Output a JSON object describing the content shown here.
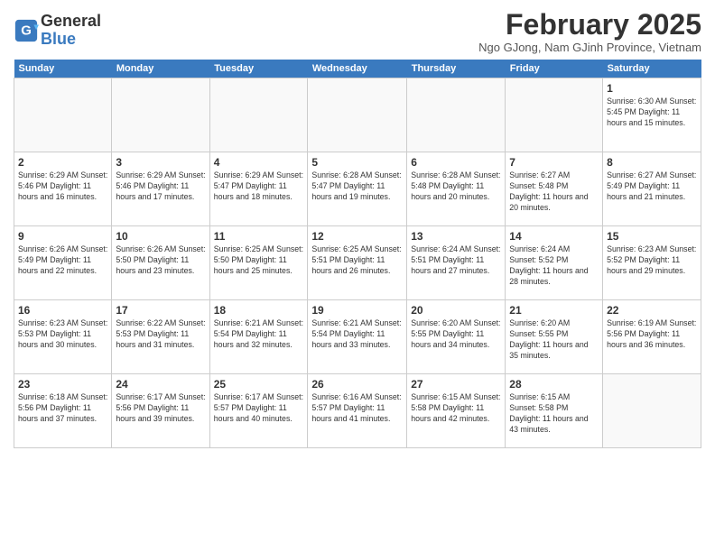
{
  "logo": {
    "line1": "General",
    "line2": "Blue"
  },
  "title": "February 2025",
  "subtitle": "Ngo GJong, Nam GJinh Province, Vietnam",
  "days_of_week": [
    "Sunday",
    "Monday",
    "Tuesday",
    "Wednesday",
    "Thursday",
    "Friday",
    "Saturday"
  ],
  "weeks": [
    [
      {
        "day": "",
        "info": ""
      },
      {
        "day": "",
        "info": ""
      },
      {
        "day": "",
        "info": ""
      },
      {
        "day": "",
        "info": ""
      },
      {
        "day": "",
        "info": ""
      },
      {
        "day": "",
        "info": ""
      },
      {
        "day": "1",
        "info": "Sunrise: 6:30 AM\nSunset: 5:45 PM\nDaylight: 11 hours and 15 minutes."
      }
    ],
    [
      {
        "day": "2",
        "info": "Sunrise: 6:29 AM\nSunset: 5:46 PM\nDaylight: 11 hours and 16 minutes."
      },
      {
        "day": "3",
        "info": "Sunrise: 6:29 AM\nSunset: 5:46 PM\nDaylight: 11 hours and 17 minutes."
      },
      {
        "day": "4",
        "info": "Sunrise: 6:29 AM\nSunset: 5:47 PM\nDaylight: 11 hours and 18 minutes."
      },
      {
        "day": "5",
        "info": "Sunrise: 6:28 AM\nSunset: 5:47 PM\nDaylight: 11 hours and 19 minutes."
      },
      {
        "day": "6",
        "info": "Sunrise: 6:28 AM\nSunset: 5:48 PM\nDaylight: 11 hours and 20 minutes."
      },
      {
        "day": "7",
        "info": "Sunrise: 6:27 AM\nSunset: 5:48 PM\nDaylight: 11 hours and 20 minutes."
      },
      {
        "day": "8",
        "info": "Sunrise: 6:27 AM\nSunset: 5:49 PM\nDaylight: 11 hours and 21 minutes."
      }
    ],
    [
      {
        "day": "9",
        "info": "Sunrise: 6:26 AM\nSunset: 5:49 PM\nDaylight: 11 hours and 22 minutes."
      },
      {
        "day": "10",
        "info": "Sunrise: 6:26 AM\nSunset: 5:50 PM\nDaylight: 11 hours and 23 minutes."
      },
      {
        "day": "11",
        "info": "Sunrise: 6:25 AM\nSunset: 5:50 PM\nDaylight: 11 hours and 25 minutes."
      },
      {
        "day": "12",
        "info": "Sunrise: 6:25 AM\nSunset: 5:51 PM\nDaylight: 11 hours and 26 minutes."
      },
      {
        "day": "13",
        "info": "Sunrise: 6:24 AM\nSunset: 5:51 PM\nDaylight: 11 hours and 27 minutes."
      },
      {
        "day": "14",
        "info": "Sunrise: 6:24 AM\nSunset: 5:52 PM\nDaylight: 11 hours and 28 minutes."
      },
      {
        "day": "15",
        "info": "Sunrise: 6:23 AM\nSunset: 5:52 PM\nDaylight: 11 hours and 29 minutes."
      }
    ],
    [
      {
        "day": "16",
        "info": "Sunrise: 6:23 AM\nSunset: 5:53 PM\nDaylight: 11 hours and 30 minutes."
      },
      {
        "day": "17",
        "info": "Sunrise: 6:22 AM\nSunset: 5:53 PM\nDaylight: 11 hours and 31 minutes."
      },
      {
        "day": "18",
        "info": "Sunrise: 6:21 AM\nSunset: 5:54 PM\nDaylight: 11 hours and 32 minutes."
      },
      {
        "day": "19",
        "info": "Sunrise: 6:21 AM\nSunset: 5:54 PM\nDaylight: 11 hours and 33 minutes."
      },
      {
        "day": "20",
        "info": "Sunrise: 6:20 AM\nSunset: 5:55 PM\nDaylight: 11 hours and 34 minutes."
      },
      {
        "day": "21",
        "info": "Sunrise: 6:20 AM\nSunset: 5:55 PM\nDaylight: 11 hours and 35 minutes."
      },
      {
        "day": "22",
        "info": "Sunrise: 6:19 AM\nSunset: 5:56 PM\nDaylight: 11 hours and 36 minutes."
      }
    ],
    [
      {
        "day": "23",
        "info": "Sunrise: 6:18 AM\nSunset: 5:56 PM\nDaylight: 11 hours and 37 minutes."
      },
      {
        "day": "24",
        "info": "Sunrise: 6:17 AM\nSunset: 5:56 PM\nDaylight: 11 hours and 39 minutes."
      },
      {
        "day": "25",
        "info": "Sunrise: 6:17 AM\nSunset: 5:57 PM\nDaylight: 11 hours and 40 minutes."
      },
      {
        "day": "26",
        "info": "Sunrise: 6:16 AM\nSunset: 5:57 PM\nDaylight: 11 hours and 41 minutes."
      },
      {
        "day": "27",
        "info": "Sunrise: 6:15 AM\nSunset: 5:58 PM\nDaylight: 11 hours and 42 minutes."
      },
      {
        "day": "28",
        "info": "Sunrise: 6:15 AM\nSunset: 5:58 PM\nDaylight: 11 hours and 43 minutes."
      },
      {
        "day": "",
        "info": ""
      }
    ]
  ]
}
